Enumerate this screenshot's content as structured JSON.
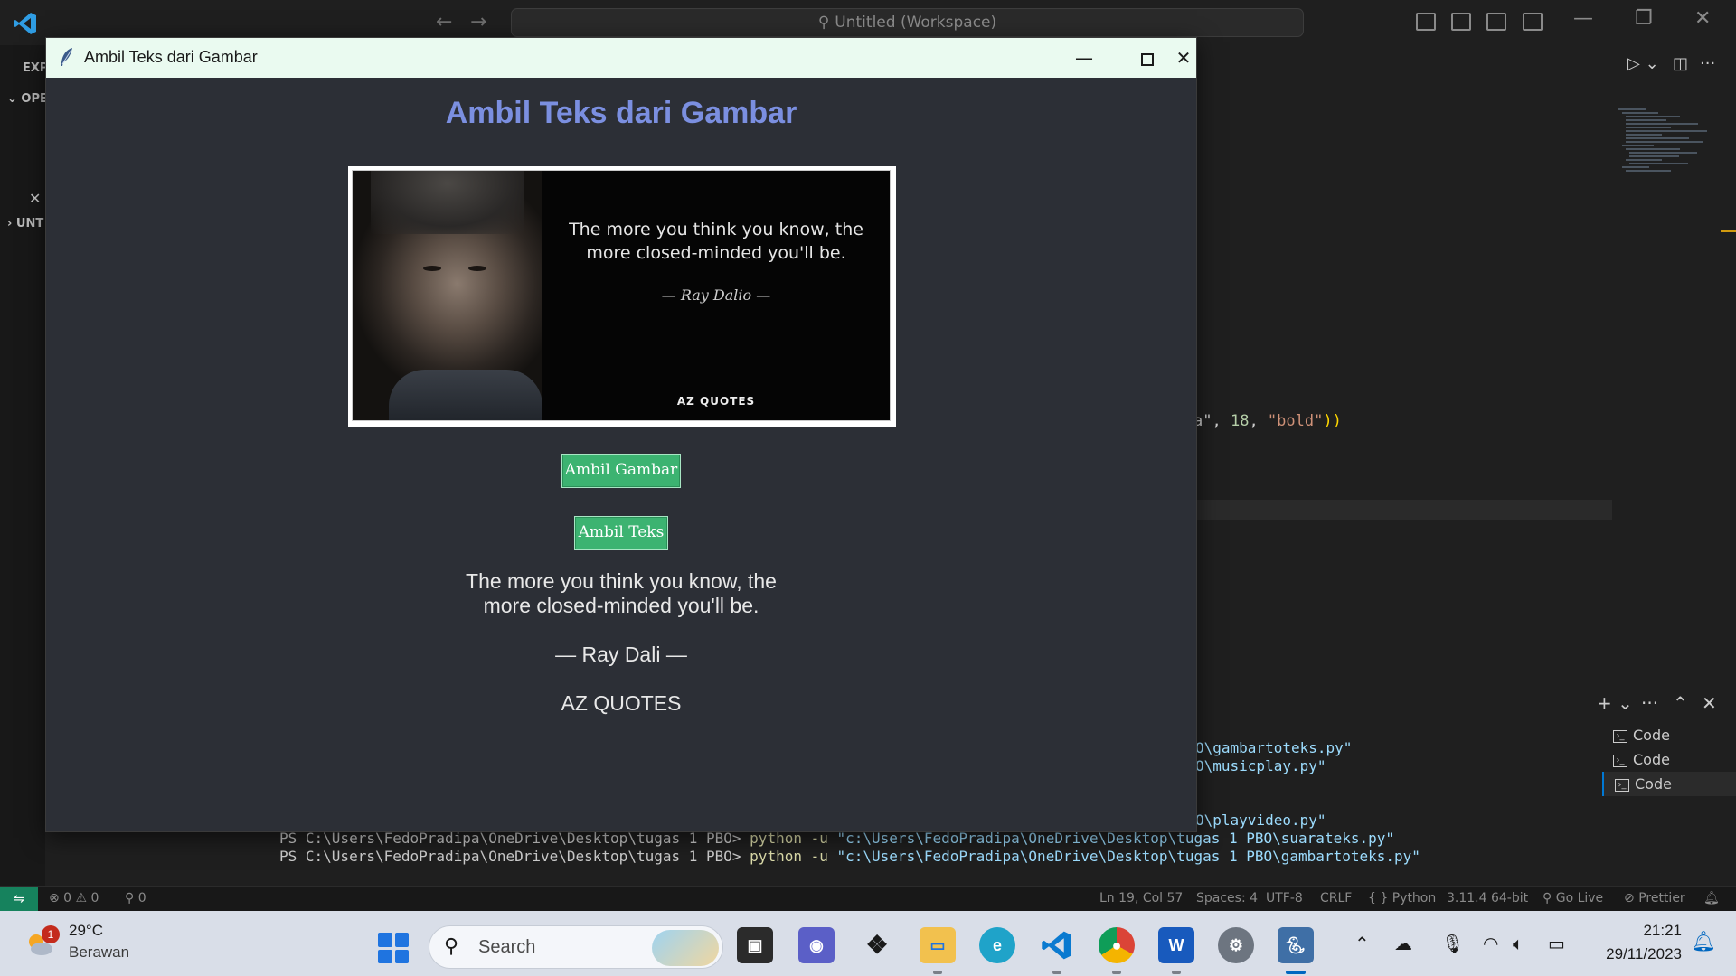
{
  "vscode": {
    "workspace_title": "Untitled (Workspace)",
    "explorer_label": "EXP",
    "open_editors_label": "OPE",
    "untitled_label": "UNT",
    "code_snippet": {
      "prefix": "a\", ",
      "num": "18",
      "sep": ", ",
      "str": "\"bold\"",
      "close": "))"
    },
    "terminal_tabs": [
      "Code",
      "Code",
      "Code"
    ],
    "terminal_lines": [
      {
        "prefix": "",
        "cmd": "",
        "path": "O\\gambartoteks.py\""
      },
      {
        "prefix": "",
        "cmd": "",
        "path": "O\\musicplay.py\""
      },
      {
        "prefix": "",
        "cmd": "",
        "path": "O\\playvideo.py\""
      },
      {
        "prefix": "PS C:\\Users\\FedoPradipa\\OneDrive\\Desktop\\tugas 1 PBO> ",
        "cmd": "python -u ",
        "path": "\"c:\\Users\\FedoPradipa\\OneDrive\\Desktop\\tugas 1 PBO\\suarateks.py\""
      },
      {
        "prefix": "PS C:\\Users\\FedoPradipa\\OneDrive\\Desktop\\tugas 1 PBO> ",
        "cmd": "python -u ",
        "path": "\"c:\\Users\\FedoPradipa\\OneDrive\\Desktop\\tugas 1 PBO\\gambartoteks.py\""
      }
    ],
    "statusbar": {
      "problems": "⊗ 0 ⚠ 0",
      "ports": "⚲ 0",
      "cursor": "Ln 19, Col 57",
      "spaces": "Spaces: 4",
      "encoding": "UTF-8",
      "eol": "CRLF",
      "language": "{ } Python",
      "interpreter": "3.11.4 64-bit",
      "golive": "Go Live",
      "prettier": "Prettier"
    }
  },
  "app": {
    "window_title": "Ambil Teks dari Gambar",
    "heading": "Ambil Teks dari Gambar",
    "image": {
      "quote": "The more you think you know, the more closed-minded you'll be.",
      "author": "— Ray Dalio —",
      "brand": "AZ QUOTES"
    },
    "button_get_image": "Ambil Gambar",
    "button_get_text": "Ambil Teks",
    "result": {
      "line1": "The more you think you know, the",
      "line2": "more closed-minded you'll be.",
      "line3": "— Ray Dali —",
      "line4": "AZ QUOTES"
    },
    "colors": {
      "heading": "#7b8fe0",
      "button": "#3cb371",
      "background": "#2c2f36"
    }
  },
  "taskbar": {
    "weather_badge": "1",
    "temperature": "29°C",
    "weather": "Berawan",
    "search_placeholder": "Search",
    "time": "21:21",
    "date": "29/11/2023",
    "pinned": [
      "task-view",
      "teams-chat",
      "dropbox",
      "file-explorer",
      "edge",
      "vscode",
      "chrome",
      "word",
      "settings",
      "python"
    ]
  }
}
